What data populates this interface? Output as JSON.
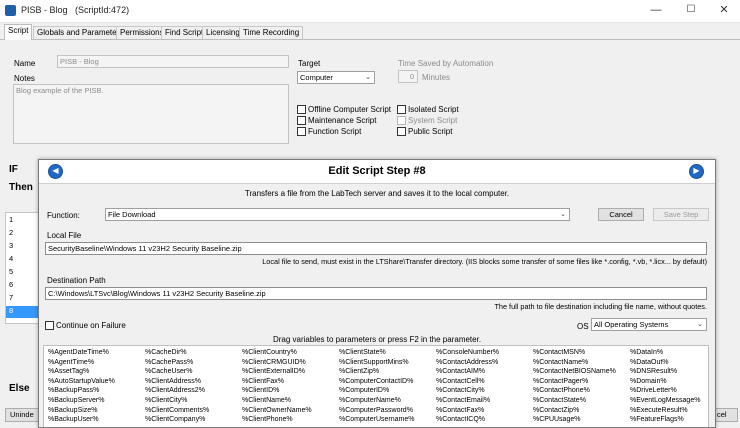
{
  "window": {
    "title": "PISB - Blog",
    "script_id": "(ScriptId:472)",
    "min": "—",
    "max": "☐",
    "close": "✕"
  },
  "tabs": [
    "Script",
    "Globals and Parameters",
    "Permissions",
    "Find Script",
    "Licensing",
    "Time Recording"
  ],
  "script_form": {
    "name_label": "Name",
    "name_value": "PISB - Blog",
    "notes_label": "Notes",
    "notes_value": "Blog example of the PISB.",
    "target_label": "Target",
    "target_value": "Computer",
    "time_saved_label": "Time Saved by Automation",
    "time_saved_value": "0",
    "minutes_label": "Minutes",
    "checkboxes": [
      {
        "label": "Offline Computer Script",
        "enabled": true
      },
      {
        "label": "Isolated Script",
        "enabled": true
      },
      {
        "label": "Maintenance Script",
        "enabled": true
      },
      {
        "label": "System Script",
        "enabled": false
      },
      {
        "label": "Function Script",
        "enabled": true
      },
      {
        "label": "Public Script",
        "enabled": true
      }
    ]
  },
  "sections": {
    "if": "IF",
    "then": "Then",
    "else": "Else"
  },
  "line_numbers": [
    "1",
    "2",
    "3",
    "4",
    "5",
    "6",
    "7",
    "8"
  ],
  "selected_line": "8",
  "bottom_left_button": "Uninde",
  "bottom_right_fragment": "cel",
  "dialog": {
    "title": "Edit Script Step #8",
    "description": "Transfers a file from the LabTech server and saves it to the local computer.",
    "function_label": "Function:",
    "function_value": "File Download",
    "cancel_label": "Cancel",
    "save_label": "Save Step",
    "local_file_label": "Local File",
    "local_file_value": "SecurityBaseline\\Windows 11 v23H2 Security Baseline.zip",
    "local_file_hint": "Local file to send, must exist in the LTShare\\Transfer directory.  (IIS blocks some transfer of some files like *.config, *.vb, *.licx... by default)",
    "dest_label": "Destination Path",
    "dest_value": "C:\\Windows\\LTSvc\\Blog\\Windows 11 v23H2 Security Baseline.zip",
    "dest_hint": "The full path to file destination including file name, without quotes.",
    "continue_label": "Continue on Failure",
    "os_label": "OS",
    "os_value": "All Operating Systems",
    "drag_hint": "Drag variables to parameters or press F2 in the parameter.",
    "variables": [
      [
        "%AgentDateTime%",
        "%AgentTime%",
        "%AssetTag%",
        "%AutoStartupValue%",
        "%BackupPass%",
        "%BackupServer%",
        "%BackupSize%",
        "%BackupUser%"
      ],
      [
        "%CacheDir%",
        "%CachePass%",
        "%CacheUser%",
        "%ClientAddress%",
        "%ClientAddress2%",
        "%ClientCity%",
        "%ClientComments%",
        "%ClientCompany%"
      ],
      [
        "%ClientCountry%",
        "%ClientCRMGUID%",
        "%ClientExternalID%",
        "%ClientFax%",
        "%ClientID%",
        "%ClientName%",
        "%ClientOwnerName%",
        "%ClientPhone%"
      ],
      [
        "%ClientState%",
        "%ClientSupportMins%",
        "%ClientZip%",
        "%ComputerContactID%",
        "%ComputerID%",
        "%ComputerName%",
        "%ComputerPassword%",
        "%ComputerUsername%"
      ],
      [
        "%ConsoleNumber%",
        "%ContactAddress%",
        "%ContactAIM%",
        "%ContactCell%",
        "%ContactCity%",
        "%ContactEmail%",
        "%ContactFax%",
        "%ContactICQ%"
      ],
      [
        "%ContactMSN%",
        "%ContactName%",
        "%ContactNetBIOSName%",
        "%ContactPager%",
        "%ContactPhone%",
        "%ContactState%",
        "%ContactZip%",
        "%CPUUsage%"
      ],
      [
        "%DataIn%",
        "%DataOut%",
        "%DNSResult%",
        "%Domain%",
        "%DriveLetter%",
        "%EventLogMessage%",
        "%ExecuteResult%",
        "%FeatureFlags%"
      ]
    ]
  }
}
